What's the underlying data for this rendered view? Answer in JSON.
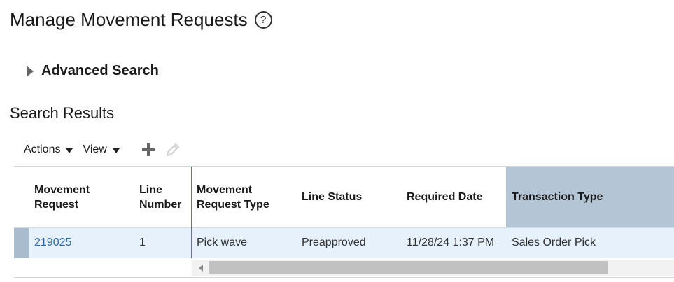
{
  "page": {
    "title": "Manage Movement Requests",
    "help_icon": "help-circle-icon"
  },
  "advanced_search": {
    "label": "Advanced Search",
    "expanded": false
  },
  "results": {
    "title": "Search Results",
    "toolbar": {
      "actions_label": "Actions",
      "view_label": "View",
      "add_icon": "plus-icon",
      "edit_icon": "pencil-icon",
      "edit_enabled": false
    },
    "columns": [
      {
        "key": "movement_request",
        "label": "Movement\nRequest"
      },
      {
        "key": "line_number",
        "label": "Line\nNumber"
      },
      {
        "key": "movement_request_type",
        "label": "Movement\nRequest Type"
      },
      {
        "key": "line_status",
        "label": "Line Status"
      },
      {
        "key": "required_date",
        "label": "Required Date"
      },
      {
        "key": "transaction_type",
        "label": "Transaction Type"
      }
    ],
    "rows": [
      {
        "movement_request": "219025",
        "line_number": "1",
        "movement_request_type": "Pick wave",
        "line_status": "Preapproved",
        "required_date": "11/28/24 1:37 PM",
        "transaction_type": "Sales Order Pick"
      }
    ]
  },
  "colors": {
    "link": "#2a6aa8",
    "selected_row": "#e6f1fb",
    "sorted_header": "#b4c6d6",
    "frozen_divider": "#2f8f9a"
  }
}
